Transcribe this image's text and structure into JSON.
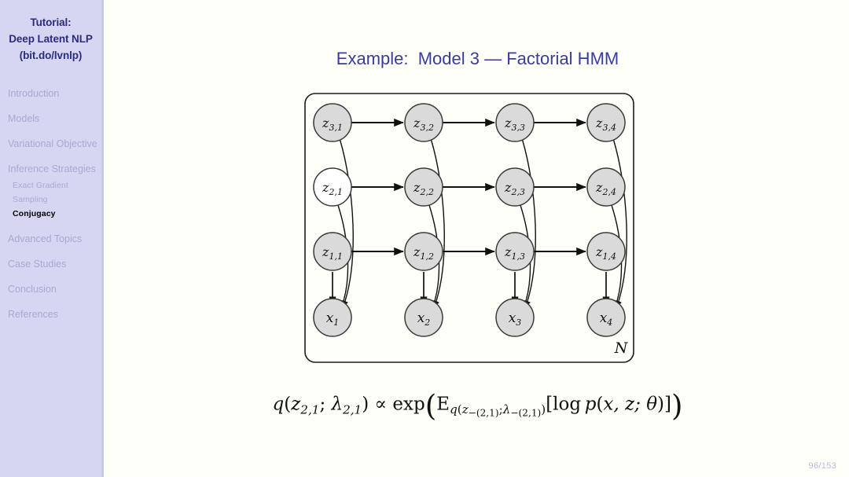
{
  "sidebar": {
    "title_lines": [
      "Tutorial:",
      "Deep Latent NLP",
      "(bit.do/lvnlp)"
    ],
    "sections": [
      {
        "label": "Introduction",
        "current": false
      },
      {
        "label": "Models",
        "current": false
      },
      {
        "label": "Variational Objective",
        "current": false
      },
      {
        "label": "Inference Strategies",
        "current": false
      },
      {
        "label": "Advanced Topics",
        "current": false
      },
      {
        "label": "Case Studies",
        "current": false
      },
      {
        "label": "Conclusion",
        "current": false
      },
      {
        "label": "References",
        "current": false
      }
    ],
    "subsections": [
      {
        "label": "Exact Gradient",
        "current": false
      },
      {
        "label": "Sampling",
        "current": false
      },
      {
        "label": "Conjugacy",
        "current": true
      }
    ],
    "colors": {
      "background": "#d6d6f2",
      "title_text": "#2b2b80",
      "inactive_text": "#a9a9d4",
      "active_text": "#000000"
    }
  },
  "main": {
    "frame_title": "Example:  Model 3 — Factorial HMM",
    "title_color": "#3b3b9e",
    "page_number": "96/153"
  },
  "figure": {
    "plate_label": "N",
    "node_fill_shaded": "#dadada",
    "node_fill_unshaded": "#ffffff",
    "node_stroke": "#3a3a3a",
    "rows": [
      {
        "name": "z3",
        "nodes": [
          {
            "label": "z",
            "sub": "3,1",
            "shaded": true
          },
          {
            "label": "z",
            "sub": "3,2",
            "shaded": true
          },
          {
            "label": "z",
            "sub": "3,3",
            "shaded": true
          },
          {
            "label": "z",
            "sub": "3,4",
            "shaded": true
          }
        ]
      },
      {
        "name": "z2",
        "nodes": [
          {
            "label": "z",
            "sub": "2,1",
            "shaded": false
          },
          {
            "label": "z",
            "sub": "2,2",
            "shaded": true
          },
          {
            "label": "z",
            "sub": "2,3",
            "shaded": true
          },
          {
            "label": "z",
            "sub": "2,4",
            "shaded": true
          }
        ]
      },
      {
        "name": "z1",
        "nodes": [
          {
            "label": "z",
            "sub": "1,1",
            "shaded": true
          },
          {
            "label": "z",
            "sub": "1,2",
            "shaded": true
          },
          {
            "label": "z",
            "sub": "1,3",
            "shaded": true
          },
          {
            "label": "z",
            "sub": "1,4",
            "shaded": true
          }
        ]
      },
      {
        "name": "x",
        "nodes": [
          {
            "label": "x",
            "sub": "1",
            "shaded": true
          },
          {
            "label": "x",
            "sub": "2",
            "shaded": true
          },
          {
            "label": "x",
            "sub": "3",
            "shaded": true
          },
          {
            "label": "x",
            "sub": "4",
            "shaded": true
          }
        ]
      }
    ]
  },
  "formula": {
    "lhs_q": "q",
    "lhs_var": "z",
    "lhs_var_sub": "2,1",
    "lhs_lambda": "λ",
    "lhs_lambda_sub": "2,1",
    "propto": "∝",
    "exp": "exp",
    "expectation": "E",
    "exp_sub_q": "q",
    "exp_sub_z": "z",
    "exp_sub_z_idx": "−(2,1)",
    "exp_sub_lambda": "λ",
    "exp_sub_lambda_idx": "−(2,1)",
    "log": "log",
    "p": "p",
    "p_args": "x, z; θ",
    "plain_text": "q(z_{2,1}; λ_{2,1}) ∝ exp( E_{q(z_{−(2,1)}; λ_{−(2,1)})}[log p(x, z; θ)] )"
  }
}
